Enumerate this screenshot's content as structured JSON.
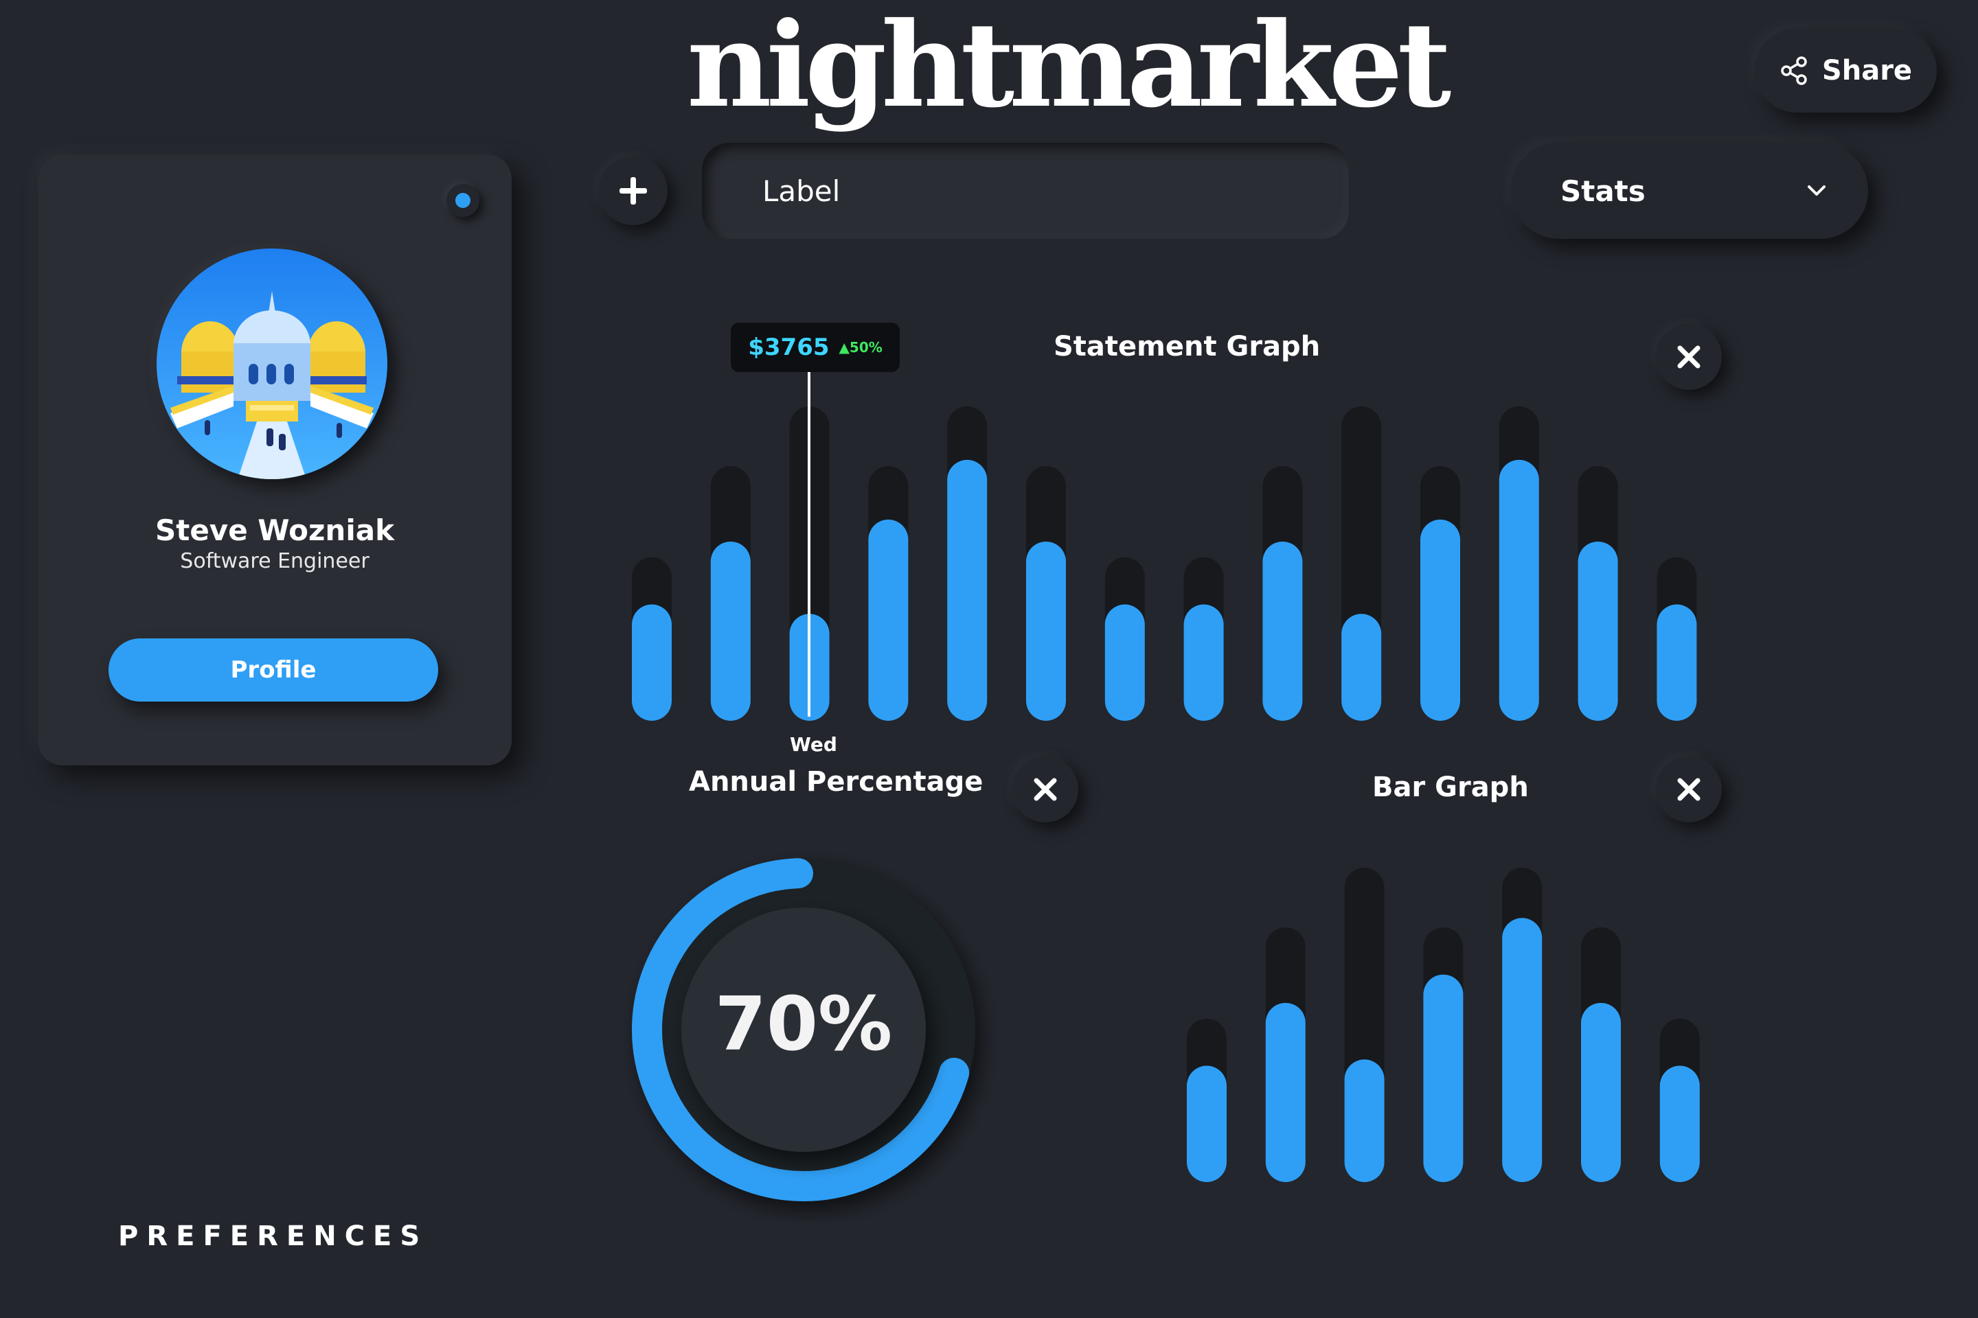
{
  "app": {
    "logo": "nightmarket"
  },
  "header": {
    "share_label": "Share",
    "share_icon": "share-icon"
  },
  "profile": {
    "name": "Steve Wozniak",
    "role": "Software Engineer",
    "button_label": "Profile",
    "status_color": "#2f9ff5"
  },
  "toolbar": {
    "label_placeholder": "Label",
    "select_value": "Stats"
  },
  "statement": {
    "title": "Statement Graph",
    "tooltip_value": "$3765",
    "tooltip_change": "50%",
    "selected_day": "Wed"
  },
  "annual": {
    "title": "Annual Percentage",
    "value_label": "70%"
  },
  "bargraph": {
    "title": "Bar Graph"
  },
  "footer": {
    "preferences_label": "PREFERENCES"
  },
  "colors": {
    "background": "#23262d",
    "accent": "#2f9ff5",
    "tooltip_value": "#3fd6ff",
    "tooltip_change": "#3ee85f"
  },
  "chart_data": [
    {
      "type": "bar",
      "title": "Statement Graph",
      "series": [
        {
          "values": [
            0.37,
            0.57,
            0.34,
            0.64,
            0.83,
            0.57,
            0.37,
            0.37,
            0.57,
            0.34,
            0.64,
            0.83,
            0.57,
            0.37
          ]
        }
      ],
      "track_levels": [
        0.52,
        0.81,
        1.0,
        0.81,
        1.0,
        0.81,
        0.52,
        0.52,
        0.81,
        1.0,
        0.81,
        1.0,
        0.81,
        0.52
      ],
      "selected_index": 2,
      "selected_label": "Wed"
    },
    {
      "type": "pie",
      "title": "Annual Percentage",
      "values": [
        70,
        30
      ],
      "center_label": "70%"
    },
    {
      "type": "bar",
      "title": "Bar Graph",
      "series": [
        {
          "values": [
            0.37,
            0.57,
            0.39,
            0.66,
            0.84,
            0.57,
            0.37
          ]
        }
      ],
      "track_levels": [
        0.52,
        0.81,
        1.0,
        0.81,
        1.0,
        0.81,
        0.52
      ]
    }
  ]
}
